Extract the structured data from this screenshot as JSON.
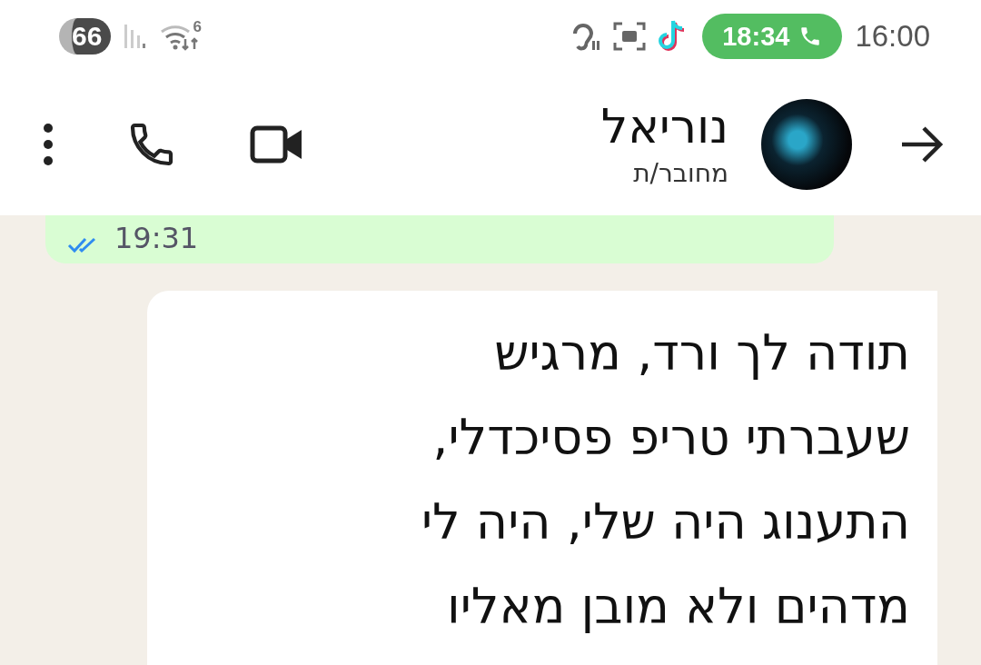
{
  "status_bar": {
    "battery": "66",
    "wifi_badge": "6",
    "call_timer": "18:34",
    "time": "16:00"
  },
  "header": {
    "contact_name": "נוריאל",
    "status": "מחובר/ת"
  },
  "messages": [
    {
      "kind": "sent",
      "time": "19:31",
      "read": true
    },
    {
      "kind": "received",
      "lines": [
        "תודה לך ורד, מרגיש",
        "שעברתי טריפ פסיכדלי,",
        "התענוג היה שלי,  היה לי",
        "מדהים ולא מובן מאליו"
      ]
    }
  ]
}
